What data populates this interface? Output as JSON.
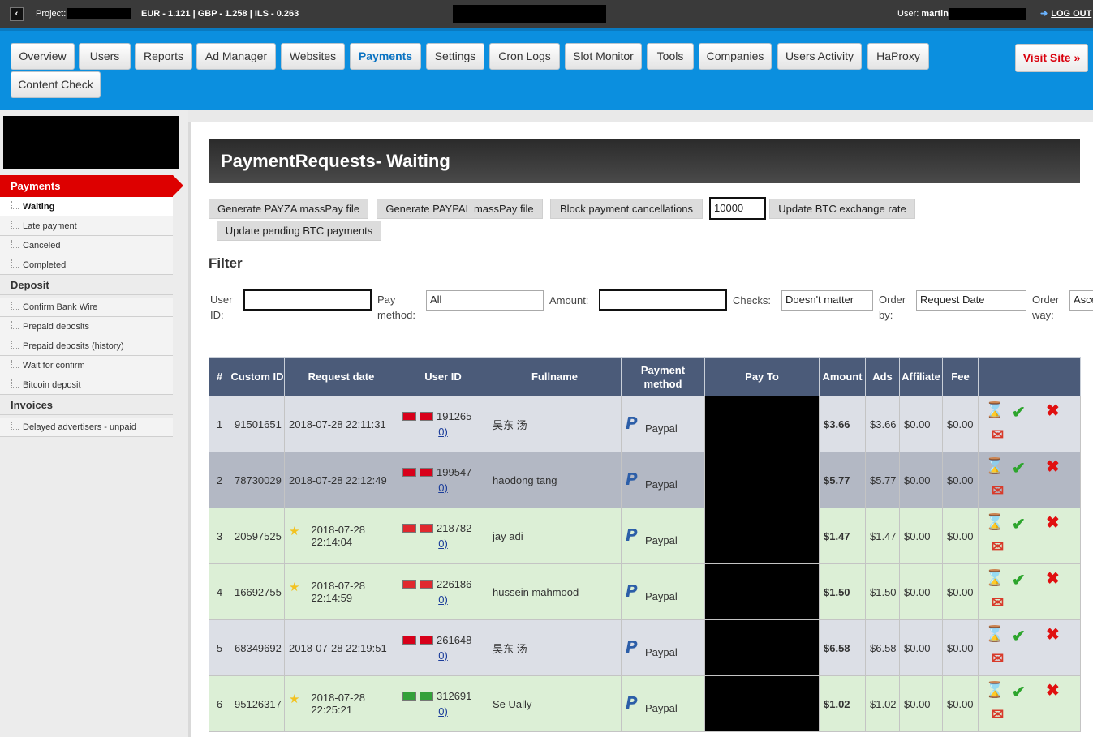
{
  "topbar": {
    "back_icon": "chevron-left-icon",
    "project_label": "Project:",
    "rates": "EUR - 1.121 | GBP - 1.258 | ILS - 0.263",
    "user_label": "User:",
    "user_name": "martin",
    "logout_label": "LOG OUT"
  },
  "nav": {
    "tabs": [
      {
        "label": "Overview"
      },
      {
        "label": "Users"
      },
      {
        "label": "Reports"
      },
      {
        "label": "Ad Manager"
      },
      {
        "label": "Websites"
      },
      {
        "label": "Payments"
      },
      {
        "label": "Settings"
      },
      {
        "label": "Cron Logs"
      },
      {
        "label": "Slot Monitor"
      },
      {
        "label": "Tools"
      },
      {
        "label": "Companies"
      },
      {
        "label": "Users Activity"
      },
      {
        "label": "HaProxy"
      },
      {
        "label": "Content Check"
      }
    ],
    "active_tab": "Payments",
    "visit_site": "Visit Site »"
  },
  "sidebar": {
    "payments_header": "Payments",
    "payments_items": [
      "Waiting",
      "Late payment",
      "Canceled",
      "Completed"
    ],
    "deposit_header": "Deposit",
    "deposit_items": [
      "Confirm Bank Wire",
      "Prepaid deposits",
      "Prepaid deposits (history)",
      "Wait for confirm",
      "Bitcoin deposit"
    ],
    "invoices_header": "Invoices",
    "invoices_items": [
      "Delayed advertisers - unpaid"
    ]
  },
  "page": {
    "title": "PaymentRequests- Waiting",
    "buttons": {
      "payza": "Generate PAYZA massPay file",
      "paypal": "Generate PAYPAL massPay file",
      "block": "Block payment cancellations",
      "btc_rate_value": "10000",
      "update_btc": "Update BTC exchange rate",
      "update_pending": "Update pending BTC payments"
    },
    "filter": {
      "heading": "Filter",
      "user_id_label": "User ID:",
      "pay_method_label": "Pay method:",
      "pay_method_value": "All",
      "amount_label": "Amount:",
      "checks_label": "Checks:",
      "checks_value": "Doesn't matter",
      "order_by_label": "Order by:",
      "order_by_value": "Request Date",
      "order_way_label": "Order way:",
      "order_way_value": "Asce"
    }
  },
  "table": {
    "headers": [
      "#",
      "Custom ID",
      "Request date",
      "User ID",
      "Fullname",
      "Payment method",
      "Pay To",
      "Amount",
      "Ads",
      "Affiliate",
      "Fee",
      ""
    ],
    "rows": [
      {
        "n": "1",
        "custom_id": "91501651",
        "date": "2018-07-28 22:11:31",
        "star": false,
        "uid": "191265",
        "link": "0)",
        "fullname": "昊东 汤",
        "method": "Paypal",
        "amount": "$3.66",
        "ads": "$3.66",
        "affiliate": "$0.00",
        "fee": "$0.00",
        "style": "grey",
        "flag_colors": [
          "#d8001a",
          "#d8001a"
        ]
      },
      {
        "n": "2",
        "custom_id": "78730029",
        "date": "2018-07-28 22:12:49",
        "star": false,
        "uid": "199547",
        "link": "0)",
        "fullname": "haodong tang",
        "method": "Paypal",
        "amount": "$5.77",
        "ads": "$5.77",
        "affiliate": "$0.00",
        "fee": "$0.00",
        "style": "dark",
        "flag_colors": [
          "#d8001a",
          "#d8001a"
        ]
      },
      {
        "n": "3",
        "custom_id": "20597525",
        "date": "2018-07-28 22:14:04",
        "star": true,
        "uid": "218782",
        "link": "0)",
        "fullname": "jay adi",
        "method": "Paypal",
        "amount": "$1.47",
        "ads": "$1.47",
        "affiliate": "$0.00",
        "fee": "$0.00",
        "style": "green",
        "flag_colors": [
          "#e0282e",
          "#e0282e"
        ]
      },
      {
        "n": "4",
        "custom_id": "16692755",
        "date": "2018-07-28 22:14:59",
        "star": true,
        "uid": "226186",
        "link": "0)",
        "fullname": "hussein mahmood",
        "method": "Paypal",
        "amount": "$1.50",
        "ads": "$1.50",
        "affiliate": "$0.00",
        "fee": "$0.00",
        "style": "green",
        "flag_colors": [
          "#e0282e",
          "#e0282e"
        ]
      },
      {
        "n": "5",
        "custom_id": "68349692",
        "date": "2018-07-28 22:19:51",
        "star": false,
        "uid": "261648",
        "link": "0)",
        "fullname": "昊东 汤",
        "method": "Paypal",
        "amount": "$6.58",
        "ads": "$6.58",
        "affiliate": "$0.00",
        "fee": "$0.00",
        "style": "grey",
        "flag_colors": [
          "#d8001a",
          "#d8001a"
        ]
      },
      {
        "n": "6",
        "custom_id": "95126317",
        "date": "2018-07-28 22:25:21",
        "star": true,
        "uid": "312691",
        "link": "0)",
        "fullname": "Se Ually",
        "method": "Paypal",
        "amount": "$1.02",
        "ads": "$1.02",
        "affiliate": "$0.00",
        "fee": "$0.00",
        "style": "green",
        "flag_colors": [
          "#34a13a",
          "#34a13a"
        ]
      }
    ]
  },
  "icons": {
    "pending": "hourglass-icon",
    "approve": "checkmark-icon",
    "reject": "cross-icon",
    "mail": "gmail-icon",
    "paypal": "paypal-icon",
    "star": "star-icon"
  },
  "colors": {
    "nav_band": "#0b8fdf",
    "active_sidebar": "#dd0000",
    "table_header": "#4b5b79"
  }
}
